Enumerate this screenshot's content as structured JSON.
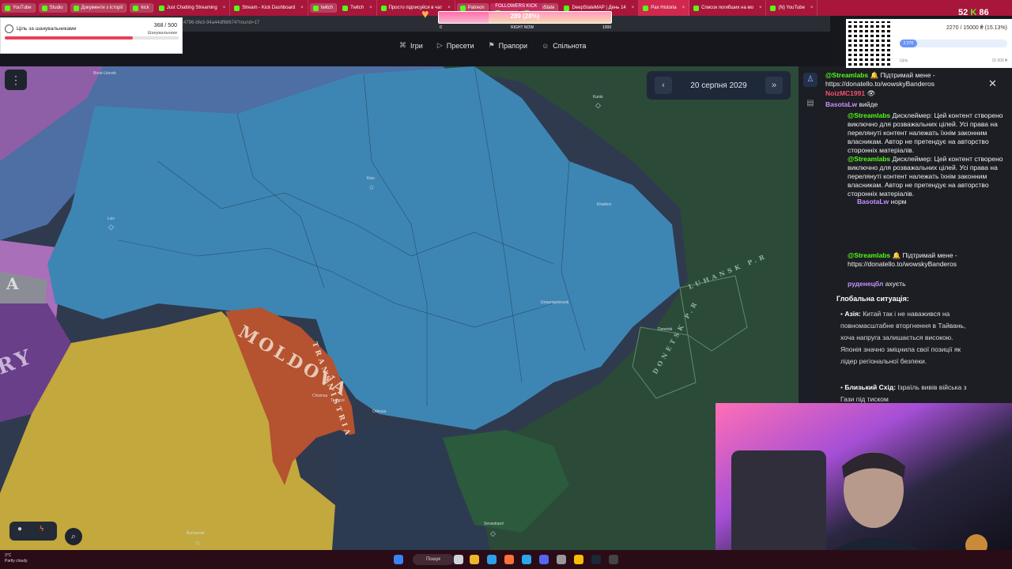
{
  "browser": {
    "tabs": [
      {
        "label": "YouTube",
        "type": "pill"
      },
      {
        "label": "Studio",
        "type": "pill"
      },
      {
        "label": "Документи з історії",
        "type": "pill"
      },
      {
        "label": "kick",
        "type": "pill"
      },
      {
        "label": "Just Chatting Streaming",
        "type": "tab"
      },
      {
        "label": "Stream - Kick Dashboard",
        "type": "tab"
      },
      {
        "label": "twitch",
        "type": "pill"
      },
      {
        "label": "Twitch",
        "type": "tab"
      },
      {
        "label": "Просто підписуйся в чат",
        "type": "tab"
      },
      {
        "label": "Patreon",
        "type": "pill"
      },
      {
        "label": "Fleks",
        "type": "pill"
      },
      {
        "label": "DeepState",
        "type": "pill"
      },
      {
        "label": "DeepStateMAP | День 14",
        "type": "tab"
      },
      {
        "label": "Pax Historia",
        "type": "active"
      },
      {
        "label": "Список погибших на мо",
        "type": "tab"
      },
      {
        "label": "(N) YouTube",
        "type": "tab"
      }
    ],
    "address": "4796-bfe3-94a44df68674?round=17"
  },
  "overlays": {
    "goal": {
      "label": "Ціль за шанувальниками",
      "value": "368 / 500",
      "sub": "Шанувальники",
      "progress": 0.736
    },
    "followers": {
      "title": "FOLLOWERS KICK",
      "count": "289 (28%)",
      "left": "0",
      "mid": "RIGHT NOW",
      "right": "1000",
      "progress": 0.289
    },
    "donate": {
      "text": "2270 / 15000 ₴ (15.13%)",
      "amount": "2 270",
      "left_label": "Ціль",
      "right_label": "15 000 ₴",
      "progress": 0.1513
    },
    "viewers": {
      "kick": "52",
      "other": "86"
    }
  },
  "app": {
    "nav": [
      {
        "icon": "gamepad-icon",
        "label": "Ігри"
      },
      {
        "icon": "play-icon",
        "label": "Пресети"
      },
      {
        "icon": "flag-icon",
        "label": "Прапори"
      },
      {
        "icon": "community-icon",
        "label": "Спільнота"
      }
    ],
    "date": "20 серпня 2029",
    "map_labels": {
      "moldova": "MOLDOVA",
      "transnistria": "TRANSNISTRIA",
      "luhansk": "LUHANSK P.R",
      "donetsk": "DONETSK P.R",
      "area_a": "A",
      "area_ry": "RY"
    },
    "cities": {
      "kiev": "Kiev",
      "lviv": "Lviv",
      "odessa": "Odessa",
      "kharkov": "Kharkov",
      "kursk": "Kursk",
      "chisinau": "Chisinau",
      "tiraspol": "Tiraspol",
      "sevastopol": "Sevastopol",
      "bucharest": "Bucharest",
      "brest": "Brest-Litovsk",
      "dnipro": "Dnepropetrovsk",
      "donetsk": "Donetsk"
    }
  },
  "chat": [
    {
      "user": "@Streamlabs",
      "text": "🔔 Підтримай мене - https://donatello.to/wowskyBanderos"
    },
    {
      "user": "NoizMC1991",
      "text": "👁"
    },
    {
      "user": "BasotaLw",
      "text": "вийде"
    },
    {
      "user": "@Streamlabs",
      "text": "Дисклеймер: Цей контент створено виключно для розважальних цілей. Усі права на перелянуті контент належать їхнім законним власникам. Автор не претендує на авторство сторонніх матеріалів."
    },
    {
      "user": "@Streamlabs",
      "text": "Дисклеймер: Цей контент створено виключно для розважальних цілей. Усі права на перелянуті контент належать їхнім законним власникам. Автор не претендує на авторство сторонніх матеріалів."
    },
    {
      "user": "BasotaLw",
      "text": "норм"
    },
    {
      "user": "@Streamlabs",
      "text": "🔔 Підтримай мене - https://donatello.to/wowskyBanderos"
    },
    {
      "user": "руденецбл",
      "text": "ахуєть"
    }
  ],
  "panel": {
    "title": "Глобальна ситуація:",
    "bullets": [
      {
        "head": "Азія:",
        "text": "Китай так і не наважився на повномасштабне вторгнення в Тайвань, хоча напруга залишається високою. Японія значно зміцнила свої позиції як лідер регіональної безпеки."
      },
      {
        "head": "Близький Схід:",
        "text": "Ізраїль вивів війська з Гази під тиском"
      }
    ]
  },
  "taskbar": {
    "weather_temp": "3°C",
    "weather_desc": "Partly cloudy",
    "search": "Пошук"
  },
  "colors": {
    "ukraine": "#3d86b4",
    "moldova": "#b5522f",
    "romania": "#c2a83d",
    "russia": "#2b4a38",
    "belarus_pl": "#4e6fa3",
    "tab_bar": "#a8163b"
  }
}
